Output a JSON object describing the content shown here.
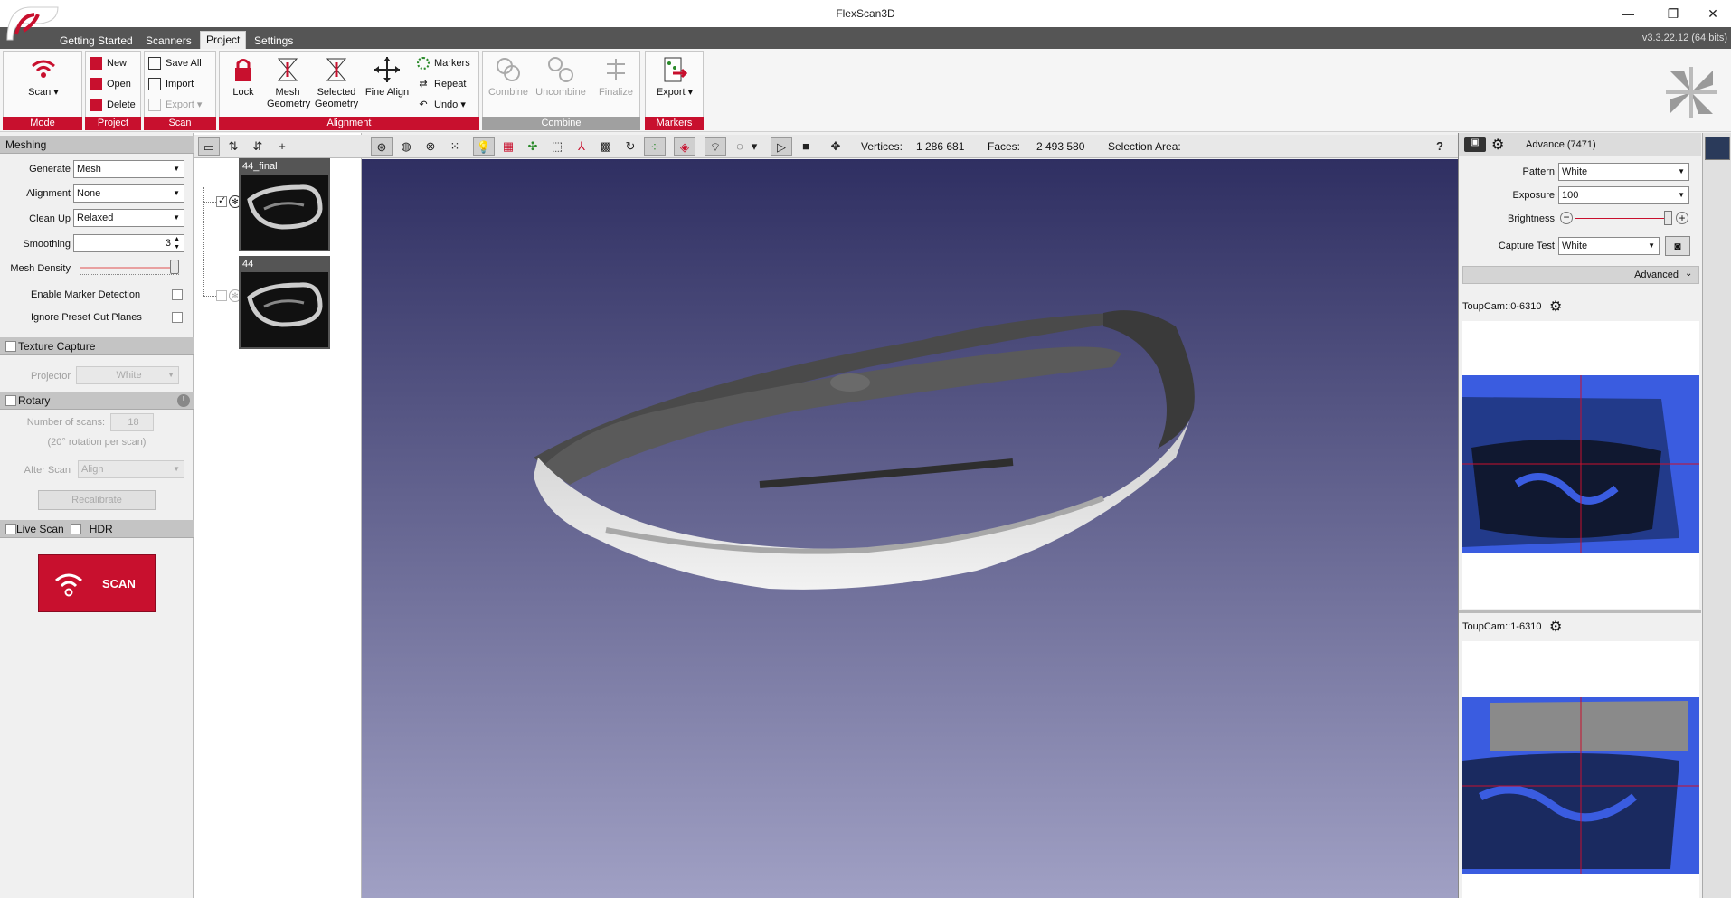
{
  "window": {
    "title": "FlexScan3D",
    "version": "v3.3.22.12  (64 bits)"
  },
  "tabs": [
    {
      "label": "Getting Started"
    },
    {
      "label": "Scanners"
    },
    {
      "label": "Project"
    },
    {
      "label": "Settings"
    }
  ],
  "ribbon": {
    "mode": {
      "scan_label": "Scan",
      "group": "Mode"
    },
    "project": {
      "new": "New",
      "open": "Open",
      "delete": "Delete",
      "group": "Project"
    },
    "scan": {
      "save_all": "Save All",
      "import": "Import",
      "export": "Export",
      "group": "Scan"
    },
    "alignment": {
      "lock": "Lock",
      "mesh_geometry": "Mesh Geometry",
      "selected_geometry": "Selected Geometry",
      "fine_align": "Fine Align",
      "markers": "Markers",
      "repeat": "Repeat",
      "undo": "Undo",
      "group": "Alignment"
    },
    "combine": {
      "combine": "Combine",
      "uncombine": "Uncombine",
      "finalize": "Finalize",
      "group": "Combine"
    },
    "markers": {
      "export": "Export",
      "group": "Markers"
    }
  },
  "left": {
    "meshing_header": "Meshing",
    "generate_label": "Generate",
    "generate_value": "Mesh",
    "alignment_label": "Alignment",
    "alignment_value": "None",
    "cleanup_label": "Clean Up",
    "cleanup_value": "Relaxed",
    "smoothing_label": "Smoothing",
    "smoothing_value": "3",
    "mesh_density_label": "Mesh Density",
    "marker_detection": "Enable Marker Detection",
    "ignore_planes": "Ignore Preset Cut Planes",
    "texture_header": "Texture Capture",
    "projector_label": "Projector",
    "projector_value": "White",
    "rotary_header": "Rotary",
    "num_scans_label": "Number of scans:",
    "num_scans_value": "18",
    "rotation_note": "(20° rotation per scan)",
    "after_scan_label": "After Scan",
    "after_scan_value": "Align",
    "recalibrate": "Recalibrate",
    "live_scan": "Live Scan",
    "hdr": "HDR",
    "scan_button": "SCAN"
  },
  "tree": {
    "items": [
      {
        "label": "44_final"
      },
      {
        "label": "44"
      }
    ]
  },
  "viewport": {
    "vertices_label": "Vertices:",
    "vertices_value": "1 286 681",
    "faces_label": "Faces:",
    "faces_value": "2 493 580",
    "selection_label": "Selection Area:",
    "help": "?"
  },
  "right": {
    "scanner_title": "Advance (7471)",
    "pattern_label": "Pattern",
    "pattern_value": "White",
    "exposure_label": "Exposure",
    "exposure_value": "100",
    "brightness_label": "Brightness",
    "capture_test_label": "Capture Test",
    "capture_test_value": "White",
    "advanced_label": "Advanced",
    "cam0": "ToupCam::0-6310",
    "cam1": "ToupCam::1-6310"
  }
}
